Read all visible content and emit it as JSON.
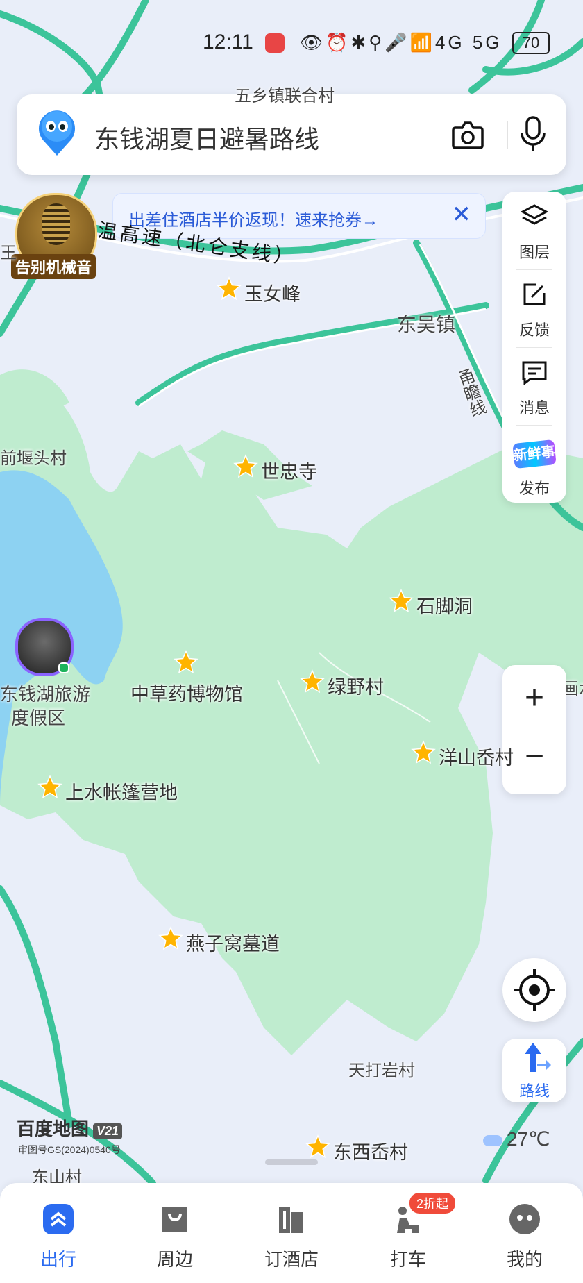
{
  "status_bar": {
    "time": "12:11",
    "icons": "👁⏰✱⚲🎤📶4G 5G",
    "battery": "70"
  },
  "search": {
    "query": "东钱湖夏日避暑路线",
    "camera_icon": "camera-icon",
    "mic_icon": "mic-icon"
  },
  "banner": {
    "text": "出差住酒店半价返现！速来抢券→",
    "close": "✕"
  },
  "tools": [
    {
      "label": "图层",
      "icon": "layers-icon"
    },
    {
      "label": "反馈",
      "icon": "feedback-icon"
    },
    {
      "label": "消息",
      "icon": "message-icon"
    },
    {
      "label": "发布",
      "icon": "publish-icon",
      "badge": "新鲜事"
    }
  ],
  "zoom": {
    "plus": "+",
    "minus": "−"
  },
  "route_label": "路线",
  "audio_avatar": {
    "label": "告别机械音"
  },
  "map": {
    "road_name": "温高速（北仑支线）",
    "road_name2": "甬瞻线",
    "places": {
      "top_village": "五乡镇联合村",
      "dongwu": "东吴镇",
      "qianyan": "前堰头村",
      "resort_line1": "东钱湖旅游",
      "resort_line2": "度假区",
      "tiandayan": "天打岩村",
      "dongshan": "东山村",
      "edge_right": "画水",
      "edge_left": "王"
    },
    "pois": [
      {
        "name": "玉女峰"
      },
      {
        "name": "世忠寺"
      },
      {
        "name": "石脚洞"
      },
      {
        "name": "绿野村"
      },
      {
        "name": "中草药博物馆"
      },
      {
        "name": "洋山岙村"
      },
      {
        "name": "上水帐篷营地"
      },
      {
        "name": "燕子窝墓道"
      },
      {
        "name": "东西岙村"
      }
    ]
  },
  "branding": {
    "name": "百度地图",
    "version": "V21",
    "review_no": "审图号GS(2024)0540号"
  },
  "weather": {
    "temp": "27℃"
  },
  "bottom_nav": [
    {
      "label": "出行",
      "active": true
    },
    {
      "label": "周边"
    },
    {
      "label": "订酒店"
    },
    {
      "label": "打车",
      "badge": "2折起"
    },
    {
      "label": "我的"
    }
  ],
  "colors": {
    "accent": "#2b6bf0",
    "highway": "#3cc49a",
    "green_area": "#bfeccf",
    "lake": "#8dd2f2",
    "star": "#ffb400"
  }
}
